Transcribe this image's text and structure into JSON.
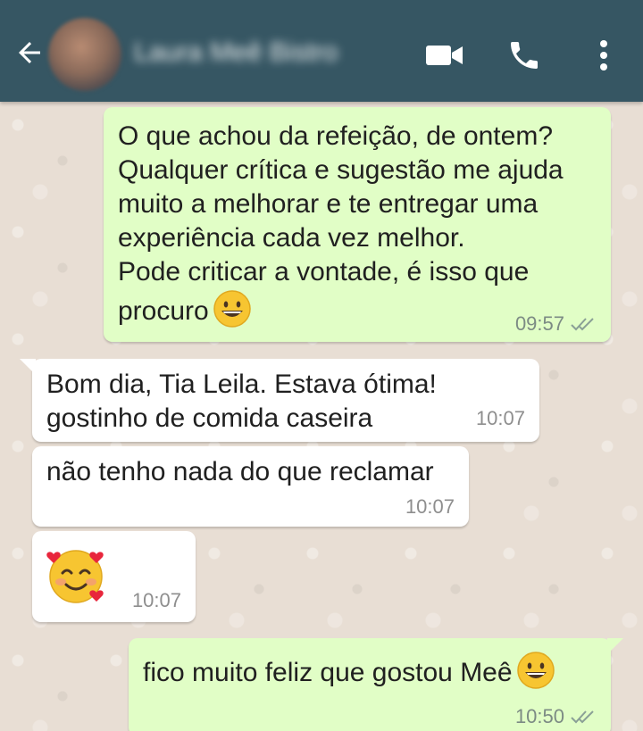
{
  "header": {
    "contact_name": "Laura Meê Bistro",
    "colors": {
      "bar": "#365663",
      "icons": "#ffffff"
    },
    "icons": {
      "back": "arrow-left-icon",
      "video": "video-camera-icon",
      "call": "phone-icon",
      "menu": "more-vert-icon"
    }
  },
  "messages": [
    {
      "direction": "sent",
      "text": "O que achou da refeição, de ontem?\nQualquer crítica e sugestão me ajuda\nmuito a melhorar e te entregar uma\nexperiência cada vez melhor.\nPode criticar a vontade, é isso que\nprocuro",
      "emoji": "grinning-face",
      "time": "09:57",
      "status": "read"
    },
    {
      "direction": "received",
      "text": "Bom dia, Tia Leila. Estava ótima!\ngostinho de comida caseira",
      "time": "10:07"
    },
    {
      "direction": "received",
      "text": "não tenho nada do que reclamar",
      "time": "10:07"
    },
    {
      "direction": "received",
      "text": "",
      "emoji": "smiling-face-with-hearts",
      "time": "10:07"
    },
    {
      "direction": "sent",
      "text": "fico muito feliz que gostou Meê",
      "emoji": "grinning-face",
      "time": "10:50",
      "status": "read"
    }
  ]
}
